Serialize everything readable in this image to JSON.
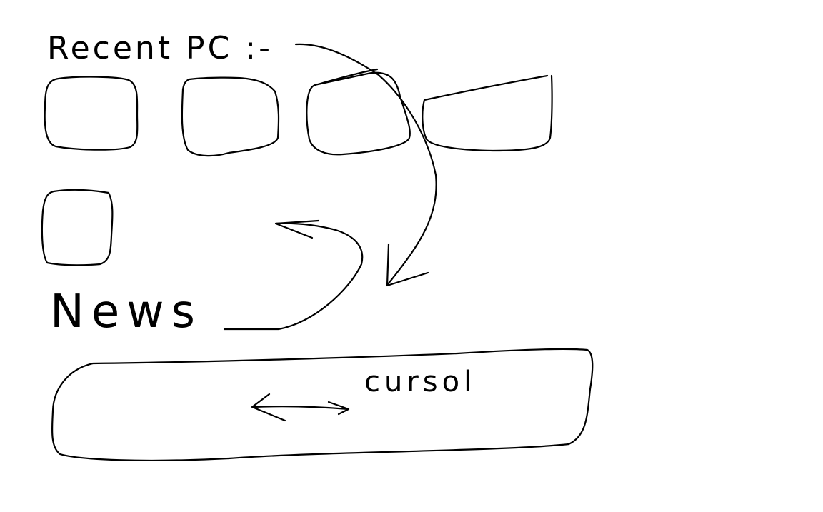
{
  "colors": {
    "ink": "#000000",
    "paper": "#ffffff"
  },
  "headings": {
    "recent_pc": "Recent PC :-",
    "news": "News"
  },
  "carousel": {
    "label": "cursol"
  }
}
